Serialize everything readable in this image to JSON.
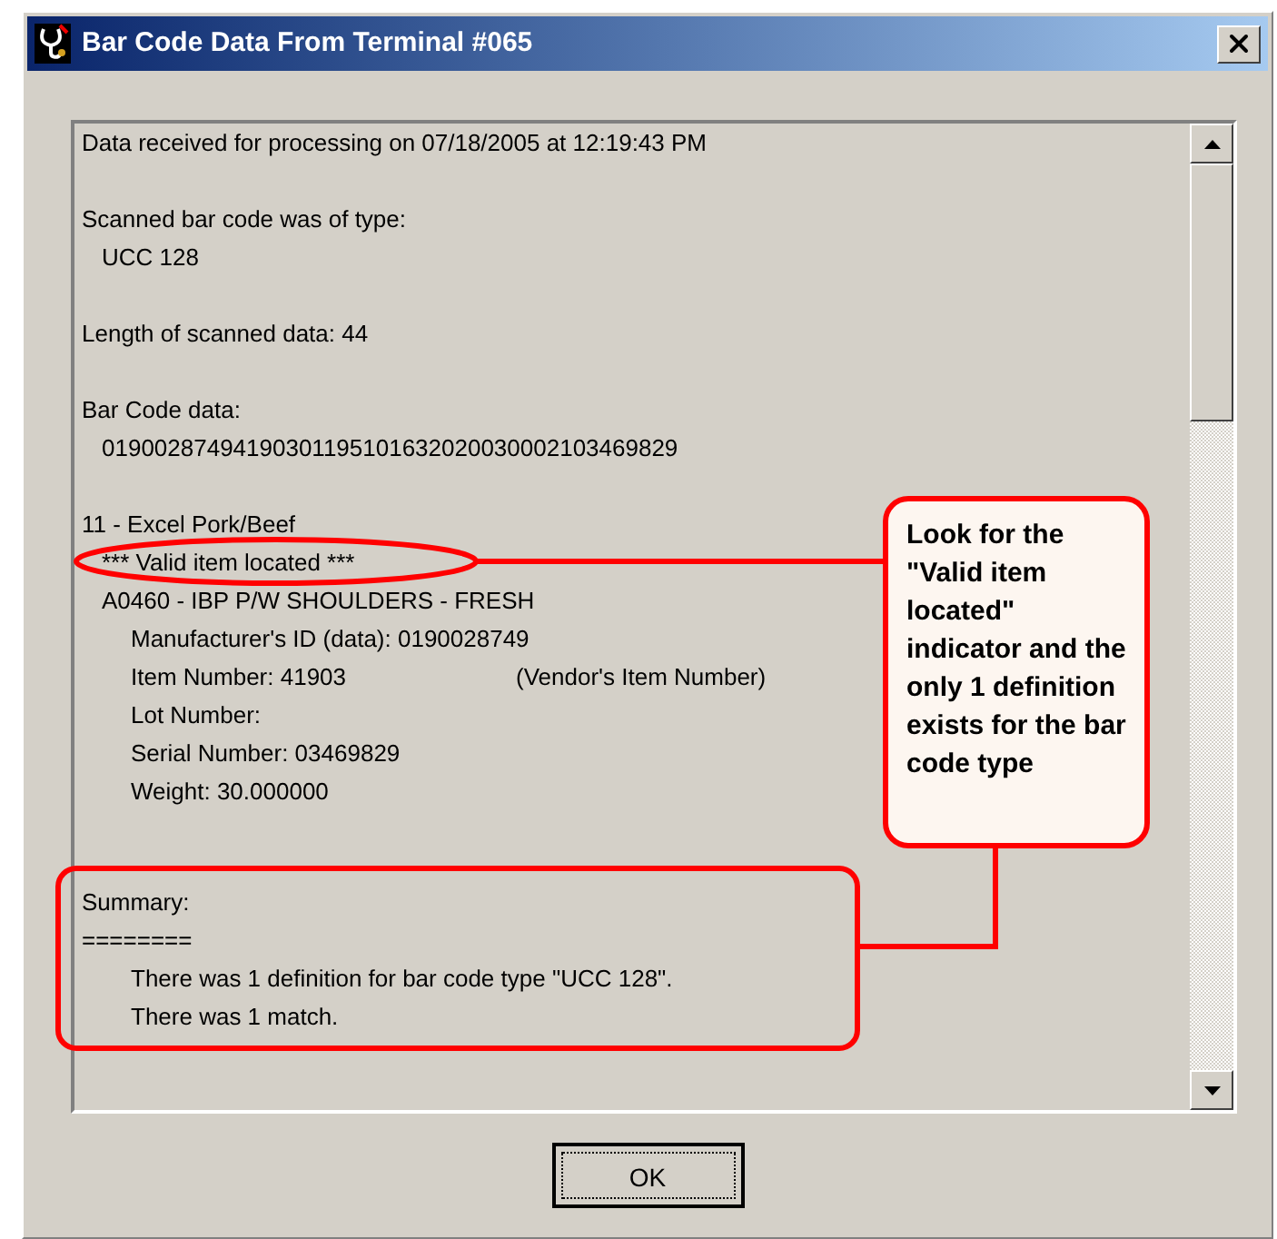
{
  "window": {
    "title": "Bar Code Data From Terminal #065"
  },
  "report": {
    "sections": [
      {
        "lines": [
          {
            "kind": "plain",
            "text": "Data received for processing on 07/18/2005 at 12:19:43 PM"
          }
        ]
      },
      {
        "lines": [
          {
            "kind": "plain",
            "text": "Scanned bar code was of type:"
          },
          {
            "kind": "sub",
            "text": "UCC 128"
          }
        ]
      },
      {
        "lines": [
          {
            "kind": "plain",
            "text": "Length of scanned data: 44"
          }
        ]
      },
      {
        "lines": [
          {
            "kind": "plain",
            "text": "Bar Code data:"
          },
          {
            "kind": "sub",
            "text": "01900287494190301195101632020030002103469829"
          }
        ]
      },
      {
        "lines": [
          {
            "kind": "plain",
            "text": "11 - Excel Pork/Beef"
          },
          {
            "kind": "sub",
            "text": "*** Valid item located ***"
          },
          {
            "kind": "sub",
            "text": "A0460 - IBP P/W SHOULDERS - FRESH"
          },
          {
            "kind": "detail",
            "text": "Manufacturer's ID (data): 0190028749"
          },
          {
            "kind": "pair",
            "text": "Item Number: 41903",
            "note": "(Vendor's Item Number)"
          },
          {
            "kind": "detail",
            "text": "Lot Number:"
          },
          {
            "kind": "detail",
            "text": "Serial Number: 03469829"
          },
          {
            "kind": "detail",
            "text": "Weight: 30.000000"
          }
        ]
      }
    ],
    "summary": {
      "lines": [
        {
          "kind": "plain",
          "text": "Summary:"
        },
        {
          "kind": "plain",
          "text": "========"
        },
        {
          "kind": "detail",
          "text": "There was 1 definition for bar code type \"UCC 128\"."
        },
        {
          "kind": "detail",
          "text": "There was 1 match."
        }
      ]
    }
  },
  "annotation": {
    "callout": "Look for the \"Valid item located\" indicator and the only 1 definition exists for the bar code type"
  },
  "buttons": [
    {
      "label": "OK"
    }
  ]
}
